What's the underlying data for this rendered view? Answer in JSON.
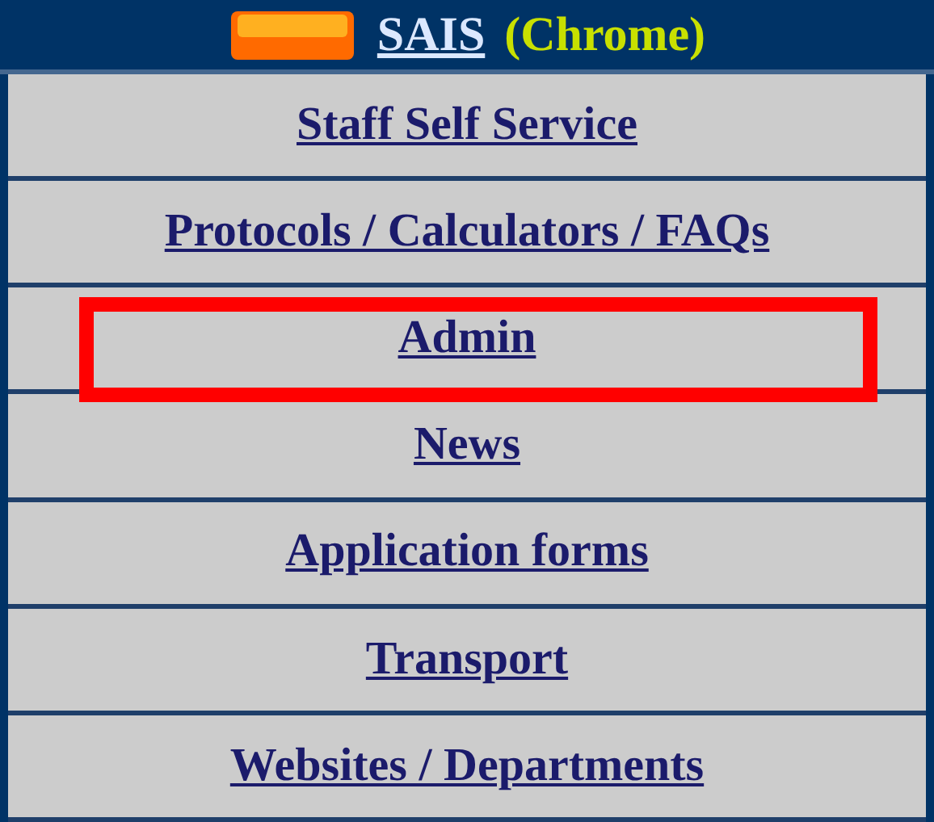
{
  "header": {
    "title": "SAIS",
    "subtitle": "(Chrome)"
  },
  "menu": [
    {
      "label": "Staff Self Service",
      "highlighted": false
    },
    {
      "label": "Protocols / Calculators / FAQs",
      "highlighted": false
    },
    {
      "label": "Admin",
      "highlighted": true
    },
    {
      "label": "News",
      "highlighted": false
    },
    {
      "label": "Application forms",
      "highlighted": false
    },
    {
      "label": "Transport",
      "highlighted": false
    },
    {
      "label": "Websites / Departments",
      "highlighted": false
    }
  ]
}
